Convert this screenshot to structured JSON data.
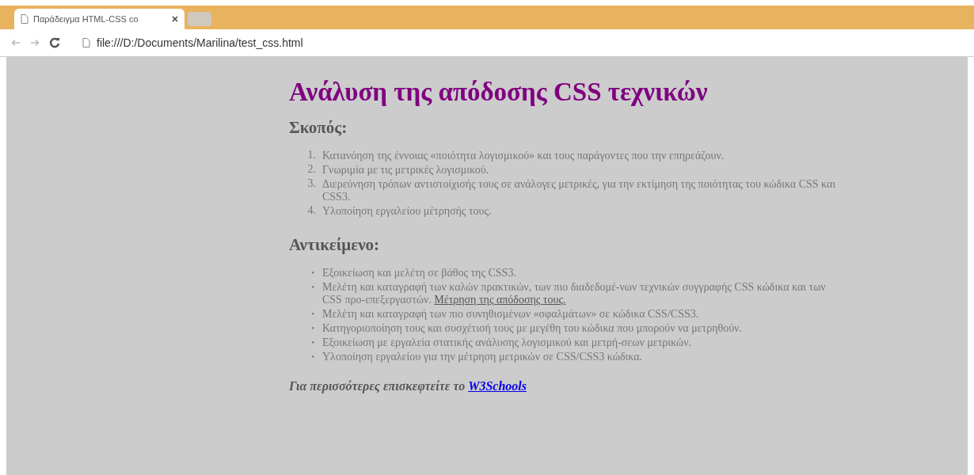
{
  "browser": {
    "tabs": [
      {
        "title": "Παράδειγμα HTML-CSS co",
        "selected": true
      },
      {
        "selected": false
      }
    ],
    "address": "file:///D:/Documents/Marilina/test_css.html"
  },
  "page": {
    "title": "Ανάλυση της απόδοσης CSS τεχνικών",
    "sections": [
      {
        "heading": "Σκοπός:",
        "kind": "ordered",
        "items": [
          {
            "marker": "1.",
            "text": "Κατανόηση της έννοιας «ποιότητα λογισμικού» και τους παράγοντες που την επηρεάζουν."
          },
          {
            "marker": "2.",
            "text": "Γνωριμία με τις μετρικές λογισμικού."
          },
          {
            "marker": "3.",
            "text": "Διερεύνηση τρόπων αντιστοίχισής τους σε ανάλογες μετρικές, για την εκτίμηση της ποιότητας του κώδικα CSS και CSS3."
          },
          {
            "marker": "4.",
            "text": "Υλοποίηση εργαλείου μέτρησής τους."
          }
        ]
      },
      {
        "heading": "Αντικείμενο:",
        "kind": "bulleted",
        "items": [
          {
            "marker": "•",
            "text": "Εξοικείωση και μελέτη σε βάθος της CSS3."
          },
          {
            "marker": "•",
            "text": "Μελέτη και καταγραφή των καλών πρακτικών, των πιο διαδεδομέ-νων τεχνικών συγγραφής CSS κώδικα και των CSS προ-επεξεργαστών.",
            "underlined": "Μέτρηση της απόδοσης τους."
          },
          {
            "marker": "•",
            "text": "Μελέτη και καταγραφή των πιο συνηθισμένων «σφαλμάτων» σε κώδικα CSS/CSS3."
          },
          {
            "marker": "•",
            "text": "Κατηγοριοποίηση τους και συσχέτισή τους με μεγέθη του κώδικα που μπορούν να μετρηθούν."
          },
          {
            "marker": "•",
            "text": "Εξοικείωση με εργαλεία στατικής ανάλυσης λογισμικού και μετρή-σεων μετρικών."
          },
          {
            "marker": "•",
            "text": "Υλοποίηση εργαλείου για την μέτρηση μετρικών σε CSS/CSS3 κώδικα."
          }
        ]
      }
    ],
    "footer": {
      "text": "Για περισσότερες επισκεφτείτε το",
      "link": "W3Schools"
    }
  }
}
